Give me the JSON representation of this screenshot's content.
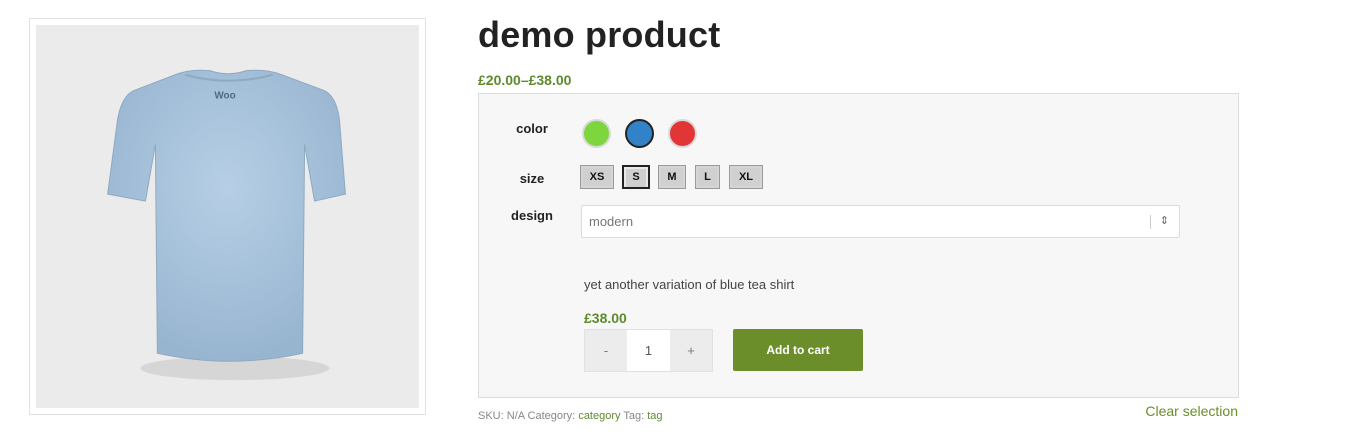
{
  "product": {
    "title": "demo product",
    "price_range": "£20.00–£38.00",
    "image_logo_text": "Woo"
  },
  "variations": {
    "color": {
      "label": "color",
      "options": [
        {
          "name": "green",
          "hex": "#7ed63e",
          "selected": false
        },
        {
          "name": "blue",
          "hex": "#3282c8",
          "selected": true
        },
        {
          "name": "red",
          "hex": "#e23636",
          "selected": false
        }
      ]
    },
    "size": {
      "label": "size",
      "options": [
        "XS",
        "S",
        "M",
        "L",
        "XL"
      ],
      "selected": "S"
    },
    "design": {
      "label": "design",
      "selected": "modern"
    },
    "description": "yet another variation of blue tea shirt",
    "price": "£38.00",
    "quantity": {
      "minus": "-",
      "value": "1",
      "plus": "+"
    },
    "add_to_cart": "Add to cart",
    "clear_selection": "Clear selection"
  },
  "meta": {
    "sku_label": "SKU:",
    "sku_value": "N/A",
    "category_label": "Category:",
    "category_value": "category",
    "tag_label": "Tag:",
    "tag_value": "tag"
  },
  "colors": {
    "accent_green": "#6b8e2a",
    "price_green": "#5e8a2e",
    "shirt_blue": "#a9c4dd"
  }
}
